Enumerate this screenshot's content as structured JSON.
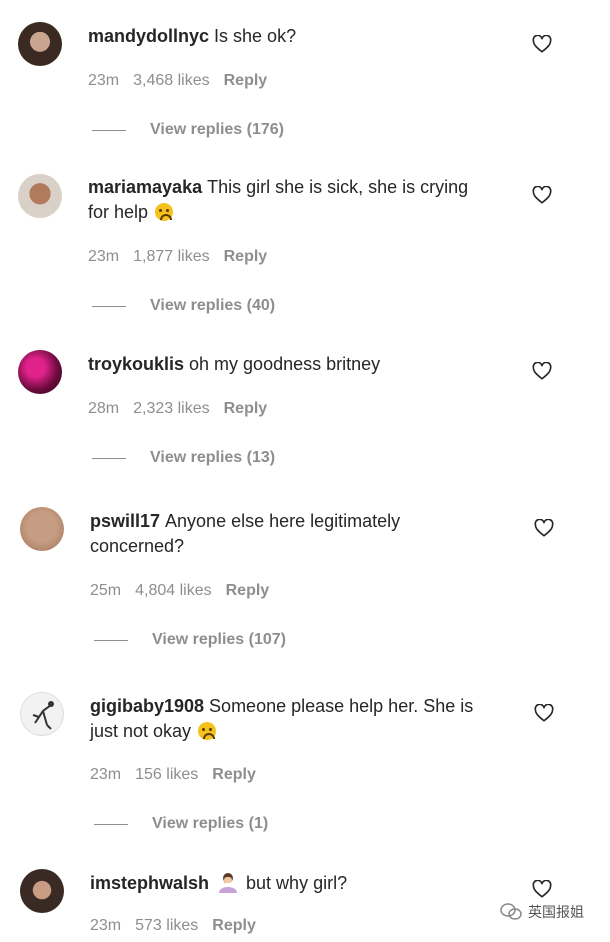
{
  "comments": [
    {
      "username": "mandydollnyc",
      "text": "Is she ok?",
      "time": "23m",
      "likes": "3,468 likes",
      "reply": "Reply",
      "view_replies": "View replies (176)"
    },
    {
      "username": "mariamayaka",
      "text": "This girl she is sick, she is crying",
      "text2": "for help",
      "time": "23m",
      "likes": "1,877 likes",
      "reply": "Reply",
      "view_replies": "View replies (40)"
    },
    {
      "username": "troykouklis",
      "text": "oh my goodness britney",
      "time": "28m",
      "likes": "2,323 likes",
      "reply": "Reply",
      "view_replies": "View replies (13)"
    },
    {
      "username": "pswill17",
      "text": "Anyone else here legitimately",
      "text2": "concerned?",
      "time": "25m",
      "likes": "4,804 likes",
      "reply": "Reply",
      "view_replies": "View replies (107)"
    },
    {
      "username": "gigibaby1908",
      "text": "Someone please help her. She is",
      "text2": "just not okay",
      "time": "23m",
      "likes": "156 likes",
      "reply": "Reply",
      "view_replies": "View replies (1)"
    },
    {
      "username": "imstephwalsh",
      "text": "but why girl?",
      "time": "23m",
      "likes": "573 likes",
      "reply": "Reply"
    }
  ],
  "watermark": {
    "text": "英国报姐"
  },
  "icons": {
    "like": "heart-outline-icon",
    "sad_emoji": "crying-face-icon",
    "person_emoji": "person-facepalm-icon",
    "watermark_logo": "wechat-logo-icon"
  }
}
